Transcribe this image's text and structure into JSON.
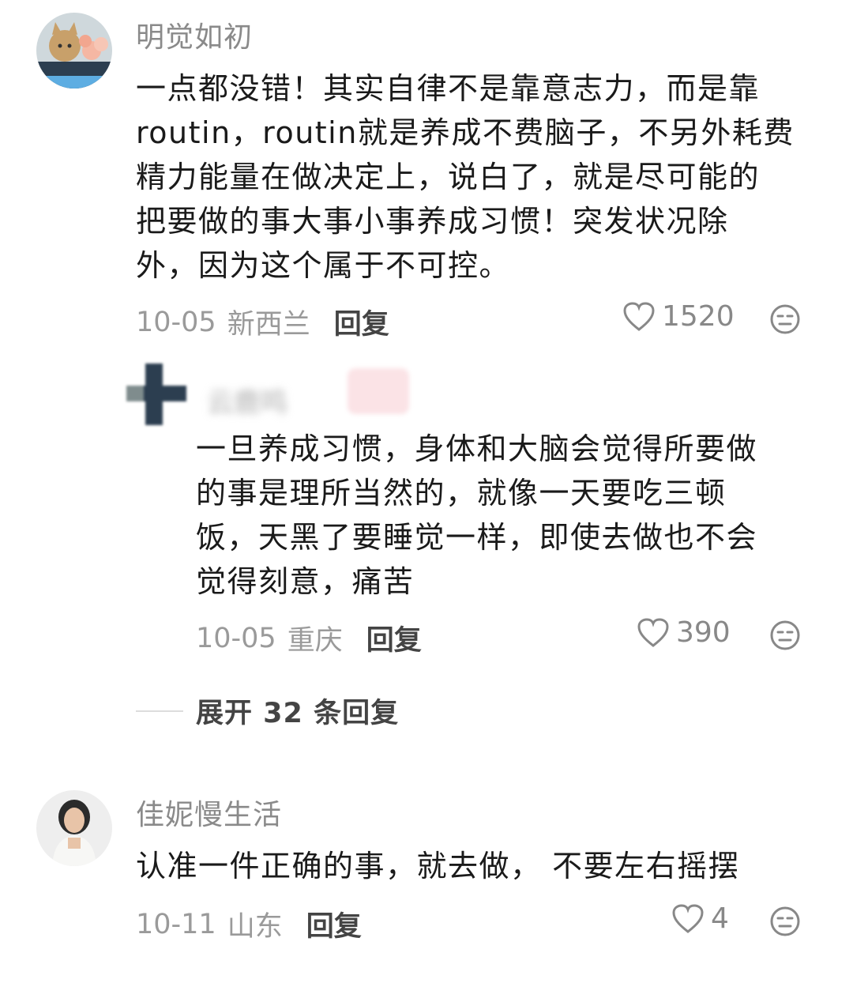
{
  "comments": [
    {
      "username": "明觉如初",
      "content_lines": [
        "一点都没错！其实自律不是靠意志力，而是靠",
        "routin，routin就是养成不费脑子，不另外耗费",
        "精力能量在做决定上，说白了，就是尽可能的",
        "把要做的事大事小事养成习惯！突发状况除",
        "外，因为这个属于不可控。"
      ],
      "date": "10-05",
      "location": "新西兰",
      "reply_label": "回复",
      "likes": "1520",
      "avatar_icon": "cat-avatar"
    },
    {
      "username": "佳妮慢生活",
      "content_lines": [
        "认准一件正确的事，就去做， 不要左右摇摆"
      ],
      "date": "10-11",
      "location": "山东",
      "reply_label": "回复",
      "likes": "4",
      "avatar_icon": "woman-avatar"
    }
  ],
  "reply": {
    "username": "云鹿鸣",
    "content_lines": [
      "一旦养成习惯，身体和大脑会觉得所要做",
      "的事是理所当然的，就像一天要吃三顿",
      "饭，天黑了要睡觉一样，即使去做也不会",
      "觉得刻意，痛苦"
    ],
    "date": "10-05",
    "location": "重庆",
    "reply_label": "回复",
    "likes": "390"
  },
  "expand_label": "展开 32 条回复",
  "colors": {
    "text": "#1a1a1a",
    "meta": "#9a9a9a",
    "username": "#8a8a8a",
    "reply_button": "#444444"
  }
}
